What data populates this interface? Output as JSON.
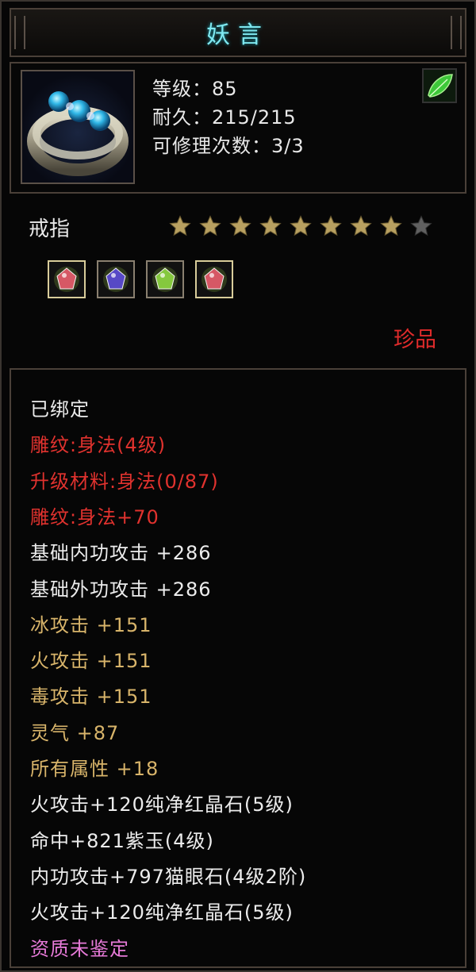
{
  "item": {
    "name": "妖言",
    "level_line": "等级：85",
    "durability_line": "耐久：215/215",
    "repair_line": "可修理次数：3/3",
    "type": "戒指",
    "stars_total": 9,
    "stars_filled": 8,
    "quality": "珍品"
  },
  "gems": [
    {
      "name": "red-crystal-gem",
      "color": "#e05a6a"
    },
    {
      "name": "purple-jade-gem",
      "color": "#5a4ad0"
    },
    {
      "name": "cats-eye-gem",
      "color": "#8ad040"
    },
    {
      "name": "red-crystal-gem",
      "color": "#e05a6a"
    }
  ],
  "attributes": [
    {
      "text": "已绑定",
      "color": "white"
    },
    {
      "text": "雕纹:身法(4级)",
      "color": "red"
    },
    {
      "text": "升级材料:身法(0/87)",
      "color": "red"
    },
    {
      "text": "雕纹:身法+70",
      "color": "red"
    },
    {
      "text": "基础内功攻击  +286",
      "color": "white"
    },
    {
      "text": "基础外功攻击  +286",
      "color": "white"
    },
    {
      "text": "冰攻击  +151",
      "color": "gold"
    },
    {
      "text": "火攻击  +151",
      "color": "gold"
    },
    {
      "text": "毒攻击  +151",
      "color": "gold"
    },
    {
      "text": "灵气  +87",
      "color": "gold"
    },
    {
      "text": "所有属性  +18",
      "color": "gold"
    },
    {
      "text": "火攻击+120纯净红晶石(5级)",
      "color": "white"
    },
    {
      "text": "命中+821紫玉(4级)",
      "color": "white"
    },
    {
      "text": "内功攻击+797猫眼石(4级2阶)",
      "color": "white"
    },
    {
      "text": "火攻击+120纯净红晶石(5级)",
      "color": "white"
    },
    {
      "text": "资质未鉴定",
      "color": "pink"
    }
  ],
  "colors": {
    "title": "#7fe8f0",
    "red": "#e0322e",
    "gold": "#d8b46a",
    "white": "#ececec",
    "pink": "#e77ad8",
    "star_filled": "#b8a060",
    "star_empty": "#606060"
  }
}
